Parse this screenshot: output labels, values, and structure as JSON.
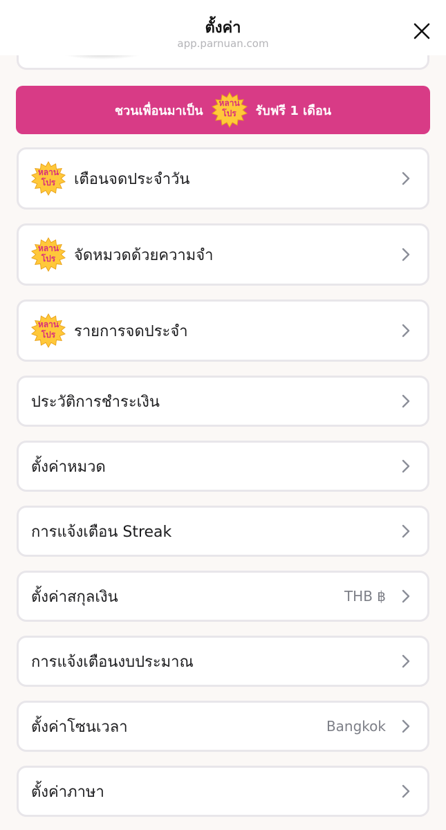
{
  "header": {
    "title": "ตั้งค่า",
    "url": "app.parnuan.com"
  },
  "invite": {
    "text_before": "ชวนเพื่อนมาเป็น",
    "badge_text": "หลาน\nโปร",
    "text_after": "รับฟรี 1 เดือน"
  },
  "badge": {
    "line1": "หลาน",
    "line2": "โปร"
  },
  "menu": {
    "items": [
      {
        "label": "เตือนจดประจำวัน",
        "value": ""
      },
      {
        "label": "จัดหมวดด้วยความจำ",
        "value": ""
      },
      {
        "label": "รายการจดประจำ",
        "value": ""
      },
      {
        "label": "ประวัติการชำระเงิน",
        "value": ""
      },
      {
        "label": "ตั้งค่าหมวด",
        "value": ""
      },
      {
        "label": "การแจ้งเตือน Streak",
        "value": ""
      },
      {
        "label": "ตั้งค่าสกุลเงิน",
        "value": "THB ฿"
      },
      {
        "label": "การแจ้งเตือนงบประมาณ",
        "value": ""
      },
      {
        "label": "ตั้งค่าโซนเวลา",
        "value": "Bangkok"
      },
      {
        "label": "ตั้งค่าภาษา",
        "value": ""
      }
    ]
  },
  "colors": {
    "invite_bg": "#d83b86",
    "badge_fill": "#ffc83a",
    "badge_text": "#d8307a",
    "chevron": "#8b8e98"
  }
}
